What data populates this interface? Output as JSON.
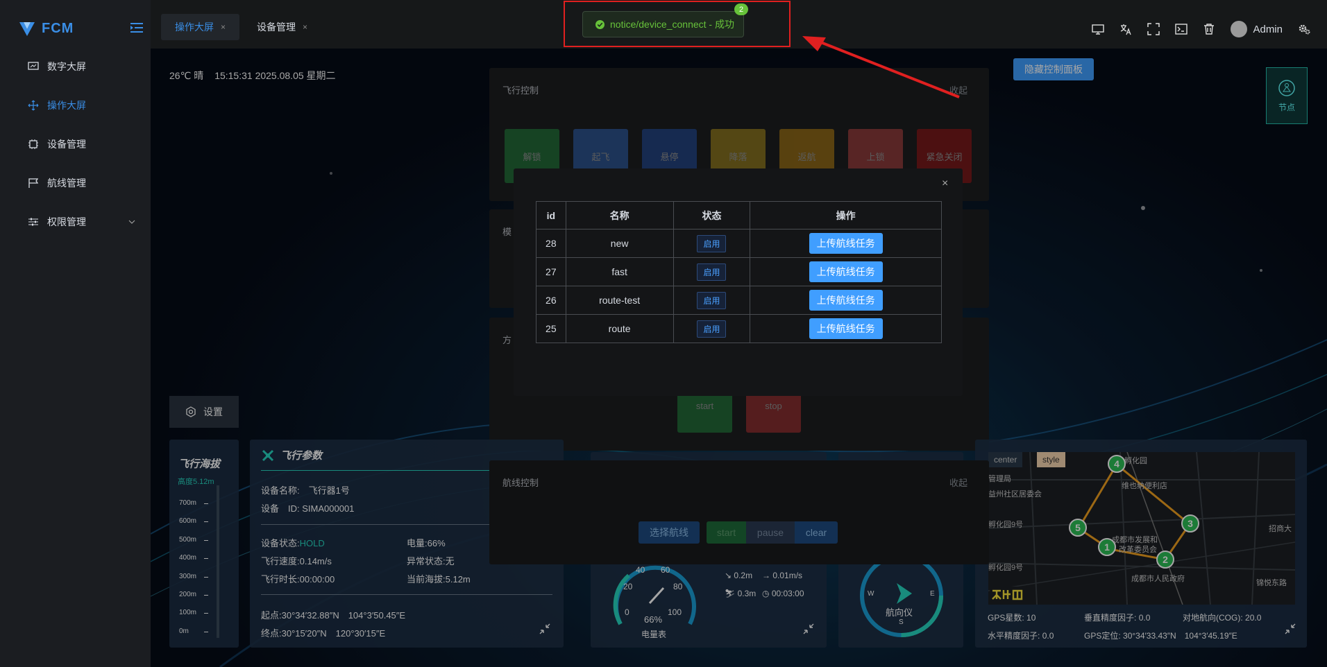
{
  "sidebar": {
    "brand": "FCM",
    "items": [
      {
        "label": "数字大屏",
        "icon": "dashboard-icon"
      },
      {
        "label": "操作大屏",
        "icon": "move-icon"
      },
      {
        "label": "设备管理",
        "icon": "chip-icon"
      },
      {
        "label": "航线管理",
        "icon": "flag-icon"
      },
      {
        "label": "权限管理",
        "icon": "sliders-icon"
      }
    ]
  },
  "tabs": [
    {
      "label": "操作大屏",
      "close": "×"
    },
    {
      "label": "设备管理",
      "close": "×"
    }
  ],
  "header": {
    "user": "Admin"
  },
  "notification": {
    "text": "notice/device_connect - 成功",
    "badge": "2"
  },
  "weather": {
    "temp": "26℃",
    "condition": "晴",
    "time": "15:15:31",
    "date": "2025.08.05",
    "weekday": "星期二"
  },
  "controls": {
    "hide_panel": "隐藏控制面板",
    "node": "节点",
    "settings": "设置"
  },
  "flight_control": {
    "title": "飞行控制",
    "collapse": "收起",
    "buttons": [
      "解锁",
      "起飞",
      "悬停",
      "降落",
      "返航",
      "上锁",
      "紧急关闭"
    ]
  },
  "panel_labels": {
    "mode": "模",
    "direction": "方"
  },
  "start_stop": {
    "start": "start",
    "stop": "stop"
  },
  "route_control": {
    "title": "航线控制",
    "collapse": "收起",
    "select": "选择航线",
    "start": "start",
    "pause": "pause",
    "clear": "clear"
  },
  "dialog": {
    "close": "×",
    "headers": [
      "id",
      "名称",
      "状态",
      "操作"
    ],
    "rows": [
      {
        "id": "28",
        "name": "new",
        "status": "启用",
        "action": "上传航线任务"
      },
      {
        "id": "27",
        "name": "fast",
        "status": "启用",
        "action": "上传航线任务"
      },
      {
        "id": "26",
        "name": "route-test",
        "status": "启用",
        "action": "上传航线任务"
      },
      {
        "id": "25",
        "name": "route",
        "status": "启用",
        "action": "上传航线任务"
      }
    ]
  },
  "altitude": {
    "title": "飞行海拔",
    "current": "高度5.12m",
    "ticks": [
      "700m",
      "600m",
      "500m",
      "400m",
      "300m",
      "200m",
      "100m",
      "0m"
    ]
  },
  "flight_params": {
    "title": "飞行参数",
    "device_name_label": "设备名称:",
    "device_name": "飞行器1号",
    "device_id_label": "设备　ID:",
    "device_id": "SIMA000001",
    "status_label": "设备状态:",
    "status": "HOLD",
    "battery_label": "电量:",
    "battery": "66%",
    "speed_label": "飞行速度:",
    "speed": "0.14m/s",
    "abnormal_label": "异常状态:",
    "abnormal": "无",
    "duration_label": "飞行时长:",
    "duration": "00:00:00",
    "altitude_label": "当前海拔:",
    "altitude": "5.12m",
    "start_label": "起点:",
    "start": "30°34′32.88″N　104°3′50.45″E",
    "end_label": "终点:",
    "end": "30°15′20″N　120°30′15″E"
  },
  "gauge": {
    "ticks": [
      "40",
      "60",
      "20",
      "80",
      "0",
      "100"
    ],
    "value": "66%",
    "label": "电量表",
    "vertical_speed": "0.2m",
    "horizontal_speed": "0.01m/s",
    "distance": "0.3m",
    "timer": "00:03:00"
  },
  "compass": {
    "label": "航向仪",
    "w": "W",
    "e": "E",
    "s": "S"
  },
  "map": {
    "center_btn": "center",
    "style_btn": "style",
    "places": [
      "孵化园",
      "管理局",
      "益州社区居委会",
      "孵化园9号",
      "成都市发展和",
      "改革委员会",
      "孵化园9号",
      "成都市人民政府",
      "招商大",
      "锦悦东路",
      "维也纳便利店"
    ],
    "markers": [
      "1",
      "2",
      "3",
      "4",
      "5"
    ],
    "gps_count_label": "GPS星数:",
    "gps_count": "10",
    "vdop_label": "垂直精度因子:",
    "vdop": "0.0",
    "cog_label": "对地航向(COG):",
    "cog": "20.0",
    "hdop_label": "水平精度因子:",
    "hdop": "0.0",
    "gps_pos_label": "GPS定位:",
    "gps_pos": "30°34′33.43″N　104°3′45.19″E"
  },
  "colors": {
    "accent": "#409eff",
    "success": "#67c23a",
    "teal": "#25c0b0"
  }
}
